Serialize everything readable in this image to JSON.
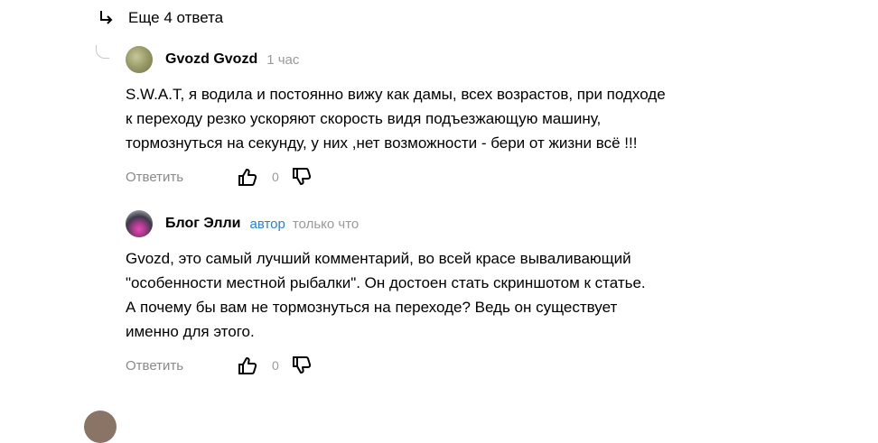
{
  "more_replies": {
    "label": "Еще 4 ответа"
  },
  "comments": [
    {
      "author": "Gvozd Gvozd",
      "badge": "",
      "time": "1 час",
      "text": "S.W.A.T, я водила и постоянно вижу как дамы, всех возрастов, при подходе\nк переходу резко ускоряют скорость видя подъезжающую машину,\nтормознуться на секунду, у них ,нет возможности - бери от жизни всё !!!",
      "reply_label": "Ответить",
      "likes": "0"
    },
    {
      "author": "Блог Элли",
      "badge": "автор",
      "time": "только что",
      "text": "Gvozd, это самый лучший комментарий, во всей красе вываливающий\n\"особенности местной рыбалки\". Он достоен стать скриншотом к статье.\nА почему бы вам не тормознуться на переходе? Ведь он существует\nименно для этого.",
      "reply_label": "Ответить",
      "likes": "0"
    }
  ],
  "colors": {
    "author_badge": "#2a7fd6",
    "muted": "#8a8a8a"
  },
  "icons": [
    "reply-arrow-icon",
    "thumbs-up-icon",
    "thumbs-down-icon"
  ]
}
